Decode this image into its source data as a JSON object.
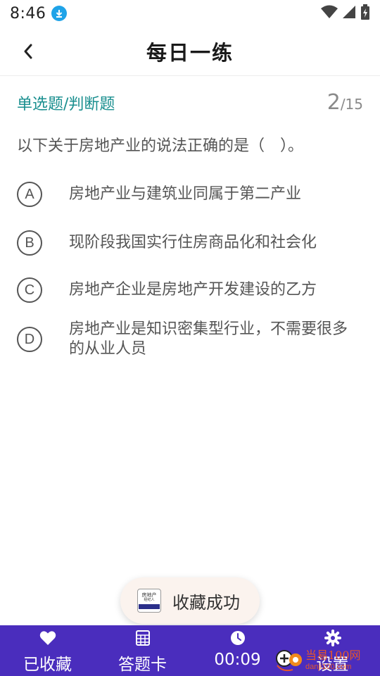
{
  "status": {
    "time": "8:46"
  },
  "header": {
    "title": "每日一练"
  },
  "question": {
    "type_label": "单选题/判断题",
    "current": "2",
    "total": "/15",
    "text": "以下关于房地产业的说法正确的是（　）。",
    "options": [
      {
        "letter": "A",
        "text": "房地产业与建筑业同属于第二产业"
      },
      {
        "letter": "B",
        "text": "现阶段我国实行住房商品化和社会化"
      },
      {
        "letter": "C",
        "text": "房地产企业是房地产开发建设的乙方"
      },
      {
        "letter": "D",
        "text": "房地产业是知识密集型行业，不需要很多的从业人员"
      }
    ]
  },
  "toast": {
    "logo_line1": "房地产",
    "logo_line2": "经纪人",
    "message": "收藏成功"
  },
  "bottom_bar": {
    "favorite_label": "已收藏",
    "answer_card_label": "答题卡",
    "timer": "00:09",
    "settings_label": "设置"
  },
  "watermark": {
    "name": "当易100网",
    "url": "danji100.com"
  },
  "colors": {
    "accent": "#1a8f8f",
    "bottom_bar": "#4a2dbd",
    "toast_bg": "#fbf3ee",
    "download_badge": "#1fa3e8"
  }
}
